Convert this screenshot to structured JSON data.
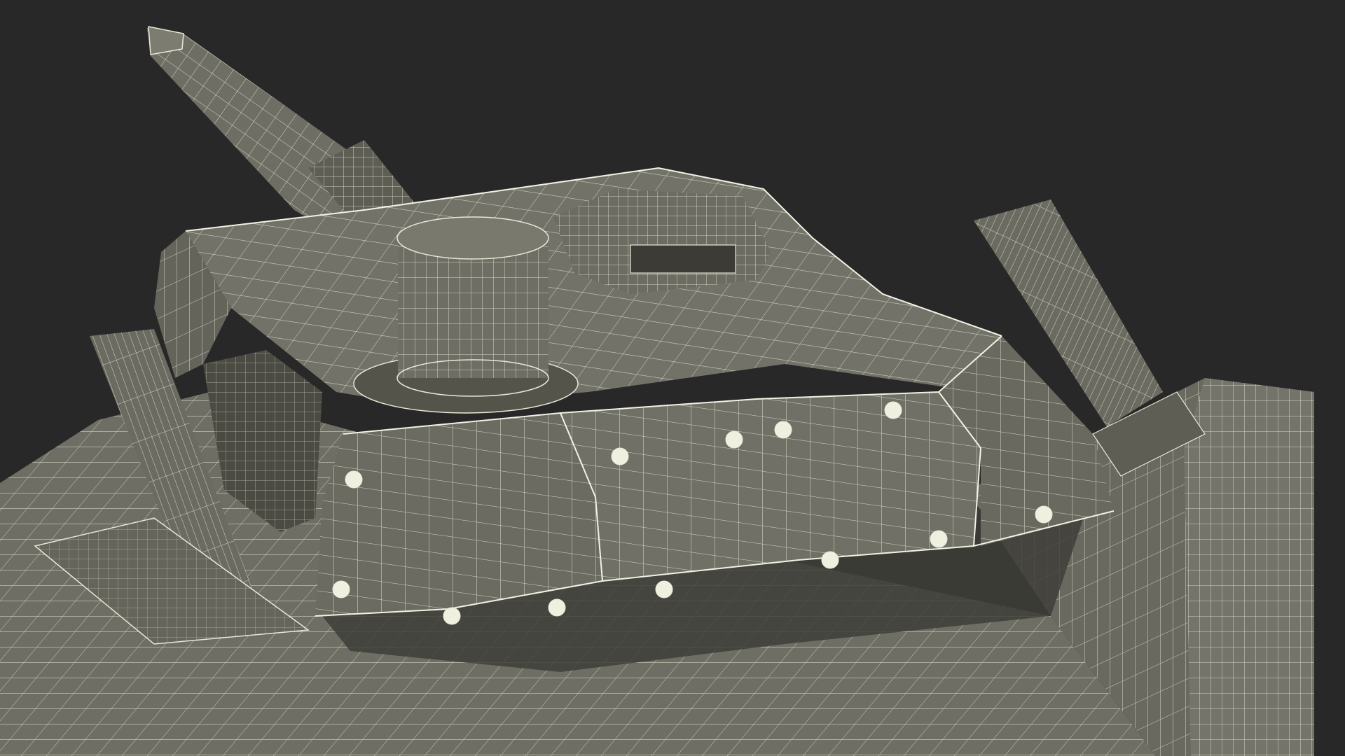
{
  "scene": {
    "subject": "tank-turret-wireframe",
    "colors": {
      "background": "#282828",
      "surface": "#6f6e64",
      "surface_dark": "#5a594f",
      "surface_light": "#7d7c71",
      "shadow": "#3a3a34",
      "wire": "#e8e8d8"
    }
  }
}
